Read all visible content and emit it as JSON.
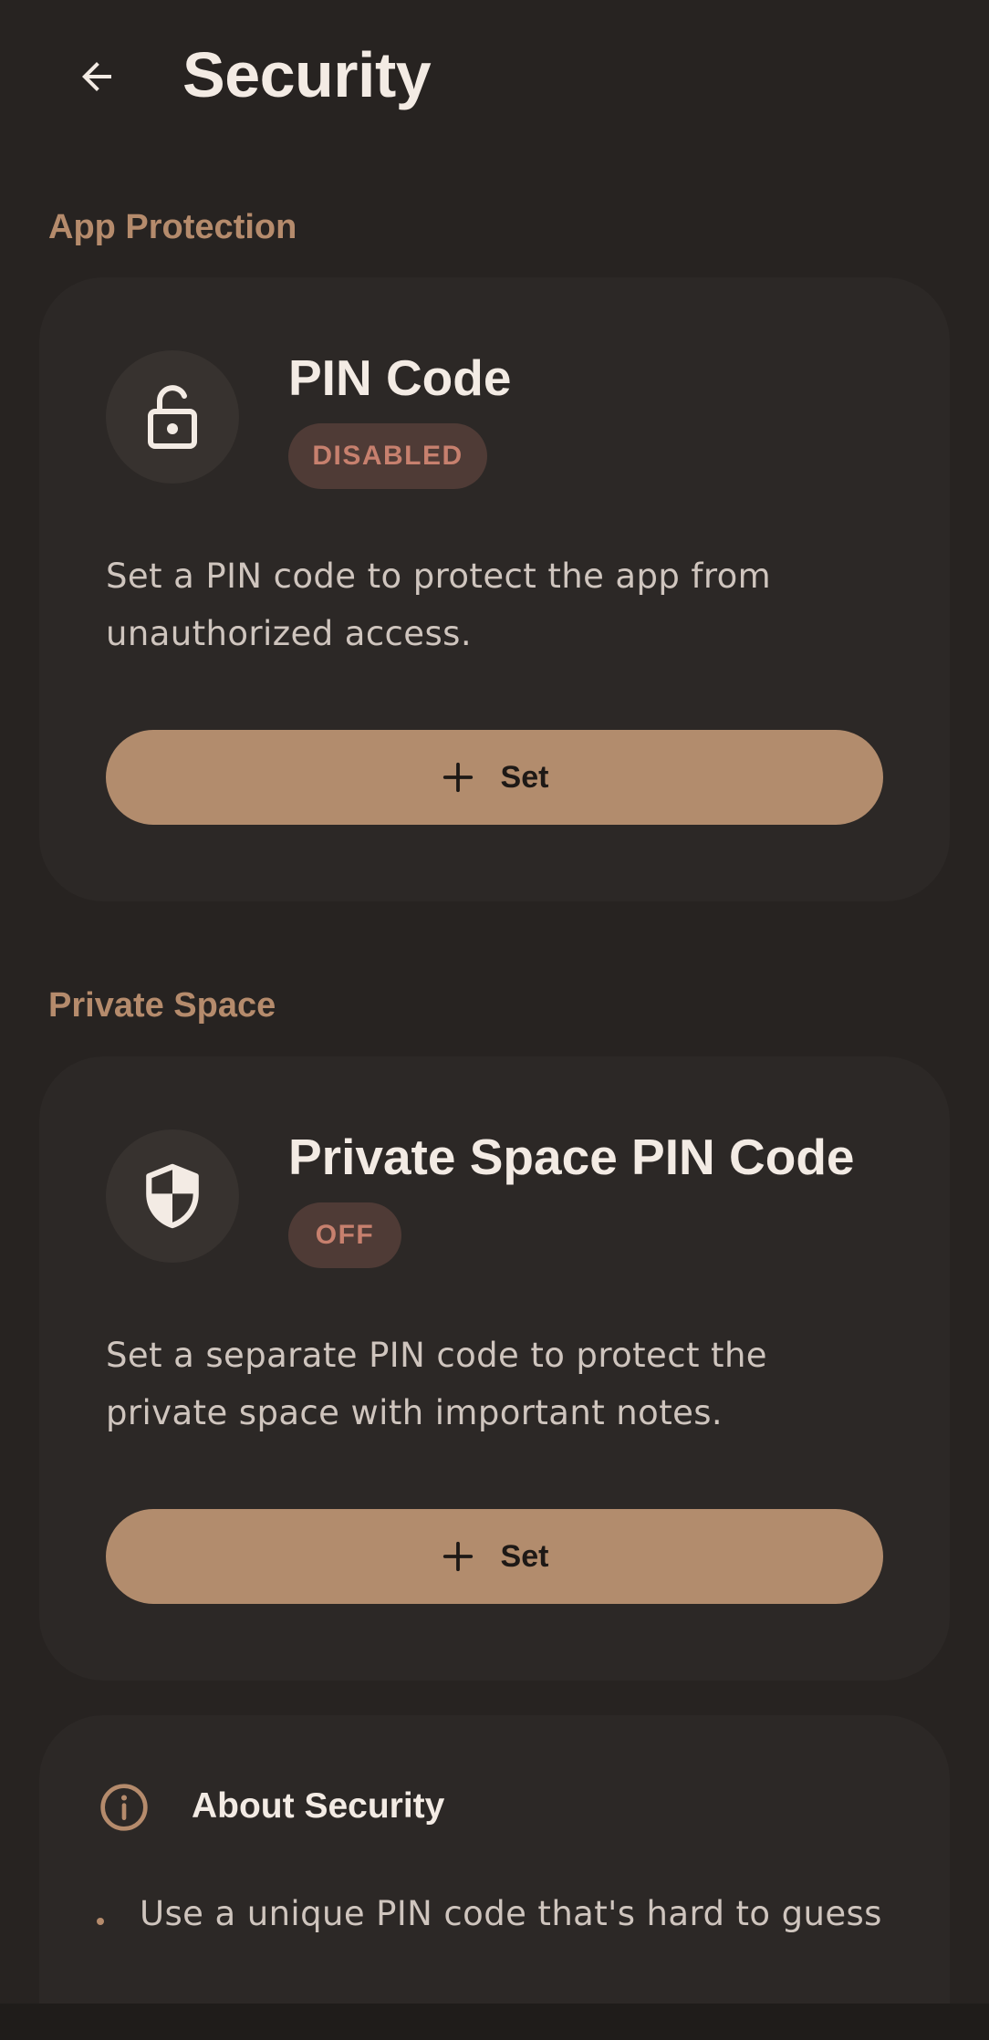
{
  "header": {
    "title": "Security",
    "back_icon": "arrow-left-icon"
  },
  "sections": {
    "app_protection": {
      "label": "App Protection",
      "pin": {
        "icon": "lock-open-icon",
        "title": "PIN Code",
        "status": "DISABLED",
        "description": "Set a PIN code to protect the app from unauthorized access.",
        "button_label": "Set",
        "button_icon": "plus-icon"
      }
    },
    "private_space": {
      "label": "Private Space",
      "pin": {
        "icon": "shield-icon",
        "title": "Private Space PIN Code",
        "status": "OFF",
        "description": "Set a separate PIN code to protect the private space with important notes.",
        "button_label": "Set",
        "button_icon": "plus-icon"
      }
    }
  },
  "about": {
    "icon": "info-icon",
    "title": "About Security",
    "tips": [
      "Use a unique PIN code that's hard to guess"
    ]
  },
  "colors": {
    "background": "#272321",
    "card": "#2c2826",
    "accent": "#b58b6c",
    "button": "#b28c6d",
    "badge_bg": "#4f3b36",
    "badge_text": "#c7806e"
  }
}
